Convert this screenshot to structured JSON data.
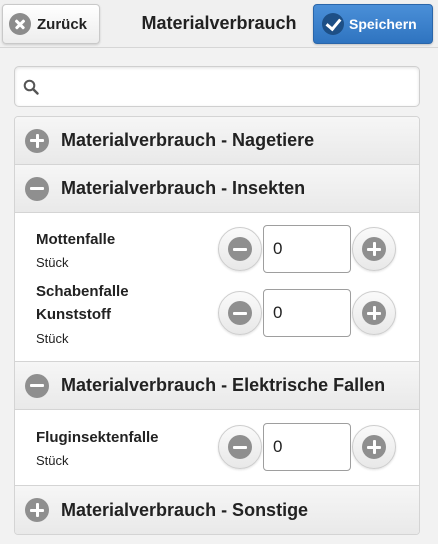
{
  "header": {
    "back_label": "Zurück",
    "title": "Materialverbrauch",
    "save_label": "Speichern"
  },
  "search": {
    "placeholder": "",
    "value": ""
  },
  "sections": [
    {
      "title": "Materialverbrauch - Nagetiere",
      "expanded": false,
      "items": []
    },
    {
      "title": "Materialverbrauch - Insekten",
      "expanded": true,
      "items": [
        {
          "name": "Mottenfalle",
          "unit": "Stück",
          "quantity": "0"
        },
        {
          "name": "Schabenfalle Kunststoff",
          "unit": "Stück",
          "quantity": "0"
        }
      ]
    },
    {
      "title": "Materialverbrauch - Elektrische Fallen",
      "expanded": true,
      "items": [
        {
          "name": "Fluginsektenfalle",
          "unit": "Stück",
          "quantity": "0"
        }
      ]
    },
    {
      "title": "Materialverbrauch - Sonstige",
      "expanded": false,
      "items": []
    }
  ],
  "icons": {
    "back": "close-icon",
    "save": "checkmark-icon",
    "search": "search-icon",
    "expand": "plus-icon",
    "collapse": "minus-icon"
  },
  "colors": {
    "accent": "#3a80cc",
    "header_bg": "#f0f0f0",
    "icon_gray": "#8f8f8f"
  }
}
